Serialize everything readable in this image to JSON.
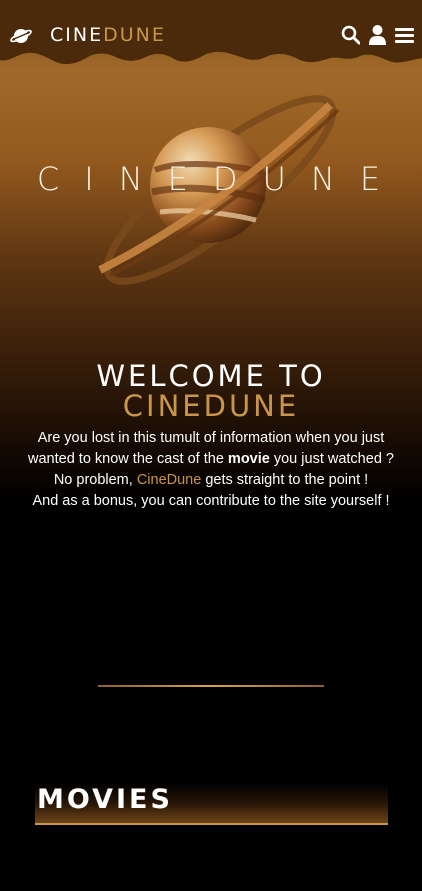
{
  "header": {
    "brand_part1": "CINE",
    "brand_part2": "DUNE",
    "icons": [
      "planet-logo-icon",
      "search-icon",
      "user-icon",
      "menu-icon"
    ]
  },
  "hero": {
    "title": "CINEDUNE"
  },
  "welcome": {
    "line1": "WELCOME TO",
    "line2": "CINEDUNE"
  },
  "intro": {
    "p1_before": "Are you lost in this tumult of information when you just wanted to know the cast of the ",
    "p1_bold": "movie",
    "p1_after": " you just watched ?",
    "p2_before": "No problem, ",
    "p2_accent": "CineDune",
    "p2_after": " gets straight to the point !",
    "p3": "And as a bonus, you can contribute to the site yourself !"
  },
  "sections": {
    "movies_title": "MOVIES"
  },
  "colors": {
    "accent": "#c8954a",
    "header_brown": "#4a2a0a",
    "background": "#000000"
  }
}
